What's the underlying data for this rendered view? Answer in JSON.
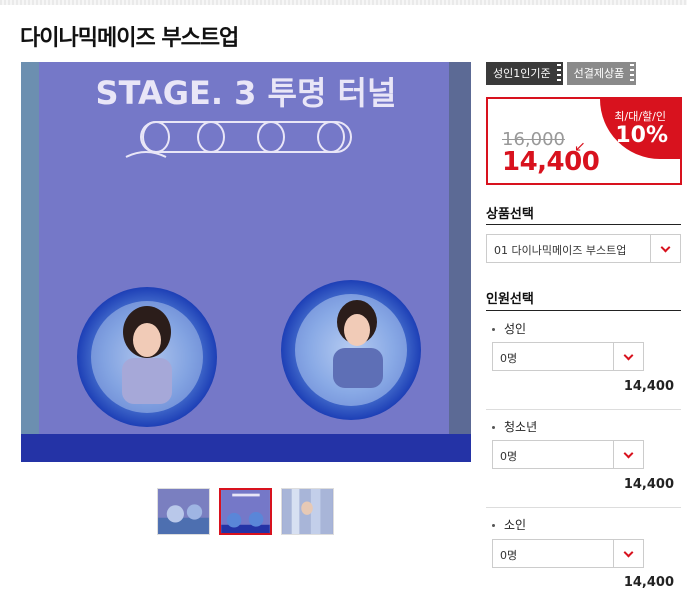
{
  "product": {
    "title": "다이나믹메이즈 부스트업",
    "image_text": "STAGE. 3 투명 터널"
  },
  "tags": [
    "성인1인기준",
    "선결제상품"
  ],
  "price": {
    "original": "16,000",
    "sale": "14,400",
    "discount_label": "최/대/할/인",
    "discount_rate": "10%"
  },
  "product_select": {
    "title": "상품선택",
    "value": "01 다이나믹메이즈 부스트업"
  },
  "people_select": {
    "title": "인원선택",
    "groups": [
      {
        "label": "성인",
        "value": "0명",
        "price": "14,400"
      },
      {
        "label": "청소년",
        "value": "0명",
        "price": "14,400"
      },
      {
        "label": "소인",
        "value": "0명",
        "price": "14,400"
      }
    ]
  },
  "colors": {
    "accent": "#d8121e",
    "wall": "#6d6fc4",
    "floor": "#2433a6"
  },
  "icons": [
    "chevron-down-icon"
  ]
}
